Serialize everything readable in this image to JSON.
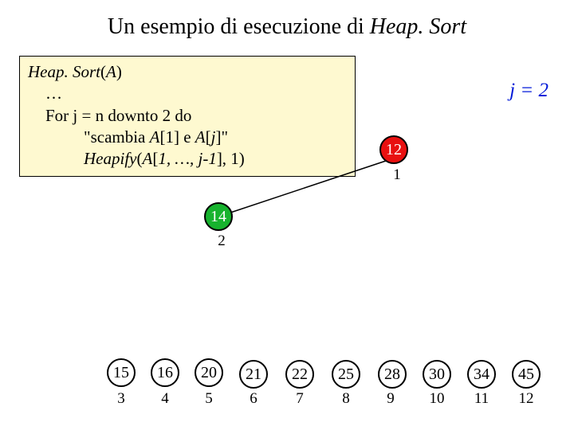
{
  "title": {
    "pre": "Un esempio di esecuzione di ",
    "alg": "Heap. Sort"
  },
  "code": {
    "l1a": "Heap. Sort",
    "l1b": "(",
    "l1c": "A",
    "l1d": ")",
    "l2": "…",
    "l3": "For j  = n downto 2 do",
    "l4a": "\"scambia ",
    "l4b": "A",
    "l4c": "[1] e ",
    "l4d": "A",
    "l4e": "[",
    "l4f": "j",
    "l4g": "]\"",
    "l5a": "Heapify",
    "l5b": "(",
    "l5c": "A",
    "l5d": "[",
    "l5e": "1, …, j-1",
    "l5f": "], 1)"
  },
  "j": {
    "label": "j = 2"
  },
  "nodes": {
    "n1": {
      "v": "12",
      "i": "1"
    },
    "n2": {
      "v": "14",
      "i": "2"
    },
    "n3": {
      "v": "15",
      "i": "3"
    },
    "n4": {
      "v": "16",
      "i": "4"
    },
    "n5": {
      "v": "20",
      "i": "5"
    },
    "n6": {
      "v": "21",
      "i": "6"
    },
    "n7": {
      "v": "22",
      "i": "7"
    },
    "n8": {
      "v": "25",
      "i": "8"
    },
    "n9": {
      "v": "28",
      "i": "9"
    },
    "n10": {
      "v": "30",
      "i": "10"
    },
    "n11": {
      "v": "34",
      "i": "11"
    },
    "n12": {
      "v": "45",
      "i": "12"
    }
  },
  "chart_data": {
    "type": "tree-diagram",
    "title": "Heap.Sort execution snapshot",
    "j_value": 2,
    "heap_nodes": [
      {
        "index": 1,
        "value": 12,
        "state": "active-red"
      },
      {
        "index": 2,
        "value": 14,
        "state": "in-heap-green"
      }
    ],
    "edges": [
      [
        1,
        2
      ]
    ],
    "sorted_output": [
      {
        "index": 3,
        "value": 15
      },
      {
        "index": 4,
        "value": 16
      },
      {
        "index": 5,
        "value": 20
      },
      {
        "index": 6,
        "value": 21
      },
      {
        "index": 7,
        "value": 22
      },
      {
        "index": 8,
        "value": 25
      },
      {
        "index": 9,
        "value": 28
      },
      {
        "index": 10,
        "value": 30
      },
      {
        "index": 11,
        "value": 34
      },
      {
        "index": 12,
        "value": 45
      }
    ]
  }
}
